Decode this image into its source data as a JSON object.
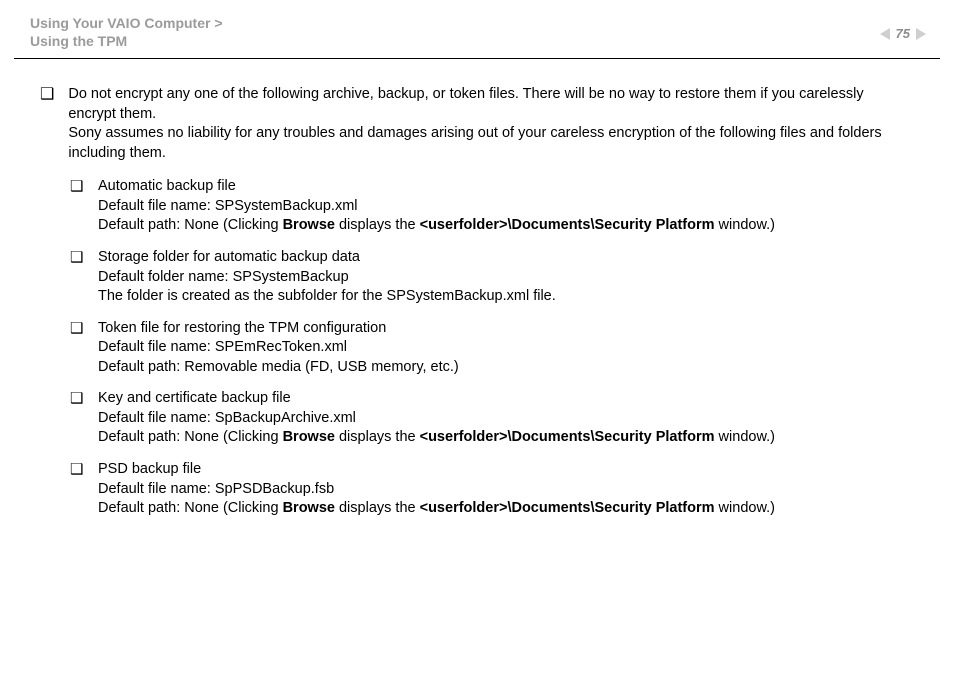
{
  "header": {
    "crumb_line1_text": "Using Your VAIO Computer",
    "crumb_line1_sep": ">",
    "crumb_line2_text": "Using the TPM",
    "page_number": "75"
  },
  "intro": {
    "p1": "Do not encrypt any one of the following archive, backup, or token files. There will be no way to restore them if you carelessly encrypt them.",
    "p2": "Sony assumes no liability for any troubles and damages arising out of your careless encryption of the following files and folders including them."
  },
  "items": {
    "b0": {
      "title": "Automatic backup file",
      "l1": "Default file name: SPSystemBackup.xml",
      "l2_pre": "Default path: None (Clicking ",
      "l2_b1": "Browse",
      "l2_mid": " displays the ",
      "l2_b2": "<userfolder>\\Documents\\Security Platform",
      "l2_post": " window.)"
    },
    "b1": {
      "title": "Storage folder for automatic backup data",
      "l1": "Default folder name: SPSystemBackup",
      "l2": "The folder is created as the subfolder for the SPSystemBackup.xml file."
    },
    "b2": {
      "title": "Token file for restoring the TPM configuration",
      "l1": "Default file name: SPEmRecToken.xml",
      "l2": "Default path: Removable media (FD, USB memory, etc.)"
    },
    "b3": {
      "title": "Key and certificate backup file",
      "l1": "Default file name: SpBackupArchive.xml",
      "l2_pre": "Default path: None (Clicking ",
      "l2_b1": "Browse",
      "l2_mid": " displays the ",
      "l2_b2": "<userfolder>\\Documents\\Security Platform",
      "l2_post": " window.)"
    },
    "b4": {
      "title": "PSD backup file",
      "l1": "Default file name: SpPSDBackup.fsb",
      "l2_pre": "Default path: None (Clicking ",
      "l2_b1": "Browse",
      "l2_mid": " displays the ",
      "l2_b2": "<userfolder>\\Documents\\Security Platform",
      "l2_post": " window.)"
    }
  },
  "markers": {
    "square": "❑"
  }
}
